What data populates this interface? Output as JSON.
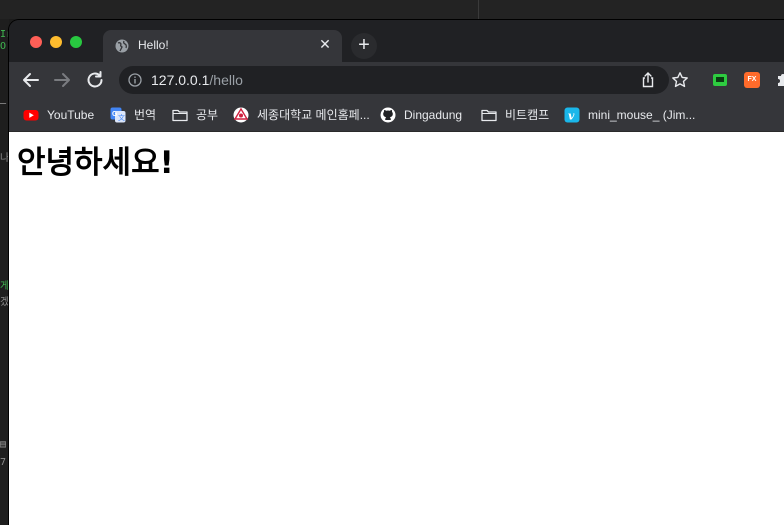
{
  "browser": {
    "tab": {
      "title": "Hello!",
      "close_glyph": "✕"
    },
    "new_tab_glyph": "+",
    "address": {
      "host": "127.0.0.1",
      "path": "/hello"
    },
    "extensions": {
      "ext2_label": "FX"
    }
  },
  "bookmarks": [
    {
      "label": "YouTube",
      "icon": "youtube-icon"
    },
    {
      "label": "번역",
      "icon": "google-translate-icon"
    },
    {
      "label": "공부",
      "icon": "folder-icon"
    },
    {
      "label": "세종대학교 메인홈페...",
      "icon": "sejong-logo-icon"
    },
    {
      "label": "Dingadung",
      "icon": "github-icon"
    },
    {
      "label": "비트캠프",
      "icon": "folder-icon"
    },
    {
      "label": "mini_mouse_ (Jim...",
      "icon": "vimeo-icon"
    }
  ],
  "page": {
    "heading": "안녕하세요!"
  },
  "colors": {
    "chrome_dark": "#202124",
    "toolbar": "#35363a",
    "content_bg": "#ffffff"
  }
}
